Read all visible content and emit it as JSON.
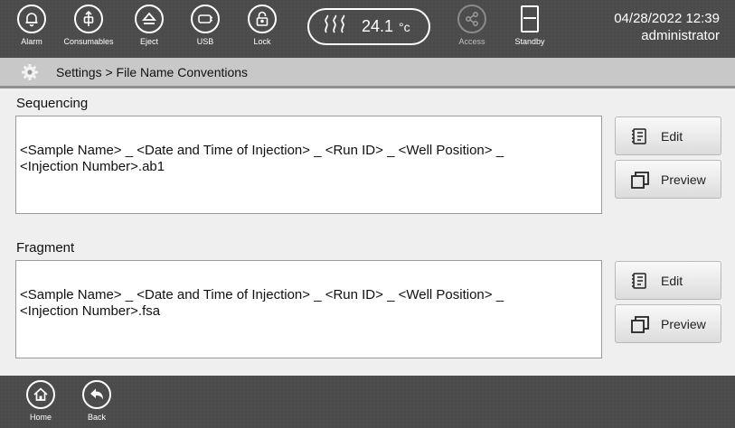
{
  "topbar": {
    "buttons": [
      {
        "label": "Alarm",
        "icon": "bell-icon"
      },
      {
        "label": "Consumables",
        "icon": "consumables-icon"
      },
      {
        "label": "Eject",
        "icon": "eject-icon"
      },
      {
        "label": "USB",
        "icon": "usb-icon"
      },
      {
        "label": "Lock",
        "icon": "lock-icon"
      },
      {
        "label": "Access",
        "icon": "share-icon"
      },
      {
        "label": "Standby",
        "icon": "standby-icon"
      }
    ],
    "temperature": {
      "value": "24.1",
      "unit": "°c"
    },
    "date_time": "04/28/2022 12:39",
    "user": "administrator"
  },
  "breadcrumb": "Settings > File Name Conventions",
  "sections": [
    {
      "title": "Sequencing",
      "line1": "<Sample Name> _ <Date and Time of Injection> _ <Run ID> _ <Well Position> _",
      "line2": "<Injection Number>.ab1",
      "edit_label": "Edit",
      "preview_label": "Preview"
    },
    {
      "title": "Fragment",
      "line1": "<Sample Name> _ <Date and Time of Injection> _ <Run ID> _ <Well Position> _",
      "line2": "<Injection Number>.fsa",
      "edit_label": "Edit",
      "preview_label": "Preview"
    }
  ],
  "bottombar": {
    "home_label": "Home",
    "back_label": "Back"
  },
  "colors": {
    "bar_background": "#4b4b4b",
    "crumb_background": "#c8c8c8",
    "page_background": "#efefef"
  }
}
